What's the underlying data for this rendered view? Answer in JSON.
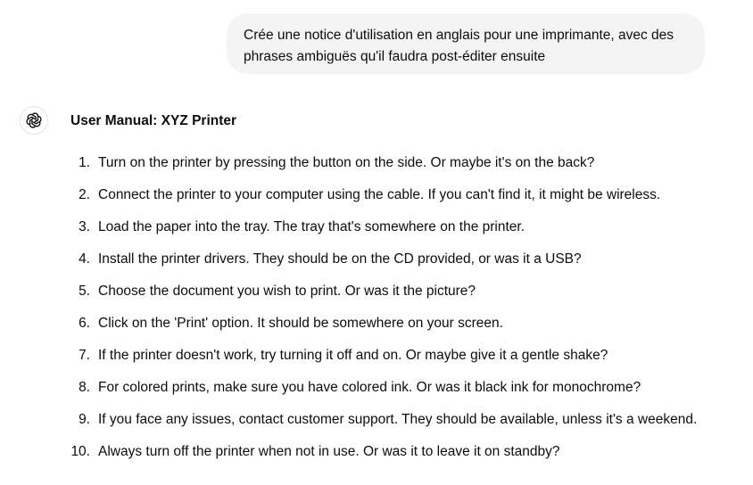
{
  "conversation": {
    "user_message": "Crée une notice d'utilisation en anglais pour une imprimante, avec des phrases ambiguës qu'il faudra post-éditer ensuite",
    "assistant": {
      "avatar_icon": "openai-logo-icon",
      "title": "User Manual: XYZ Printer",
      "items": [
        {
          "num": "1.",
          "text": "Turn on the printer by pressing the button on the side. Or maybe it's on the back?"
        },
        {
          "num": "2.",
          "text": "Connect the printer to your computer using the cable. If you can't find it, it might be wireless."
        },
        {
          "num": "3.",
          "text": "Load the paper into the tray. The tray that's somewhere on the printer."
        },
        {
          "num": "4.",
          "text": "Install the printer drivers. They should be on the CD provided, or was it a USB?"
        },
        {
          "num": "5.",
          "text": "Choose the document you wish to print. Or was it the picture?"
        },
        {
          "num": "6.",
          "text": "Click on the 'Print' option. It should be somewhere on your screen."
        },
        {
          "num": "7.",
          "text": "If the printer doesn't work, try turning it off and on. Or maybe give it a gentle shake?"
        },
        {
          "num": "8.",
          "text": "For colored prints, make sure you have colored ink. Or was it black ink for monochrome?"
        },
        {
          "num": "9.",
          "text": "If you face any issues, contact customer support. They should be available, unless it's a weekend."
        },
        {
          "num": "10.",
          "text": "Always turn off the printer when not in use. Or was it to leave it on standby?"
        }
      ]
    }
  },
  "colors": {
    "user_bubble_bg": "#f4f4f4",
    "text": "#0d0d0d"
  }
}
